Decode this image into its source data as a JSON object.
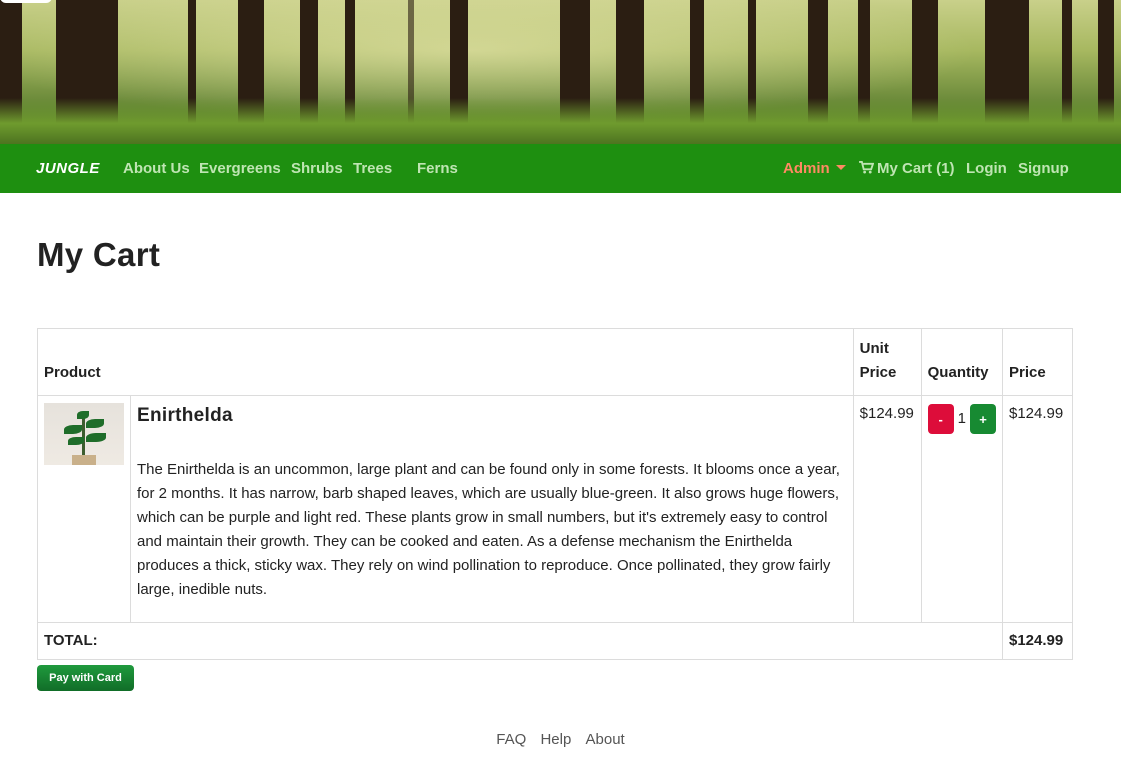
{
  "navbar": {
    "brand": "JUNGLE",
    "links": [
      "About Us",
      "Evergreens",
      "Shrubs",
      "Trees",
      "Ferns"
    ],
    "admin": "Admin",
    "cart": "My Cart (1)",
    "login": "Login",
    "signup": "Signup"
  },
  "page_title": "My Cart",
  "table": {
    "headers": [
      "Product",
      "Unit Price",
      "Quantity",
      "Price"
    ],
    "rows": [
      {
        "name": "Enirthelda",
        "description": "The Enirthelda is an uncommon, large plant and can be found only in some forests. It blooms once a year, for 2 months. It has narrow, barb shaped leaves, which are usually blue-green. It also grows huge flowers, which can be purple and light red. These plants grow in small numbers, but it's extremely easy to control and maintain their growth. They can be cooked and eaten. As a defense mechanism the Enirthelda produces a thick, sticky wax. They rely on wind pollination to reproduce. Once pollinated, they grow fairly large, inedible nuts.",
        "unit_price": "$124.99",
        "quantity": "1",
        "price": "$124.99",
        "minus": "-",
        "plus": "+"
      }
    ],
    "total_label": "TOTAL:",
    "total_value": "$124.99"
  },
  "pay_button": "Pay with Card",
  "footer": [
    "FAQ",
    "Help",
    "About"
  ],
  "colors": {
    "navbar": "#1e8f10",
    "admin": "#ff8a63",
    "minus": "#dd0d3a",
    "plus": "#178a32"
  }
}
